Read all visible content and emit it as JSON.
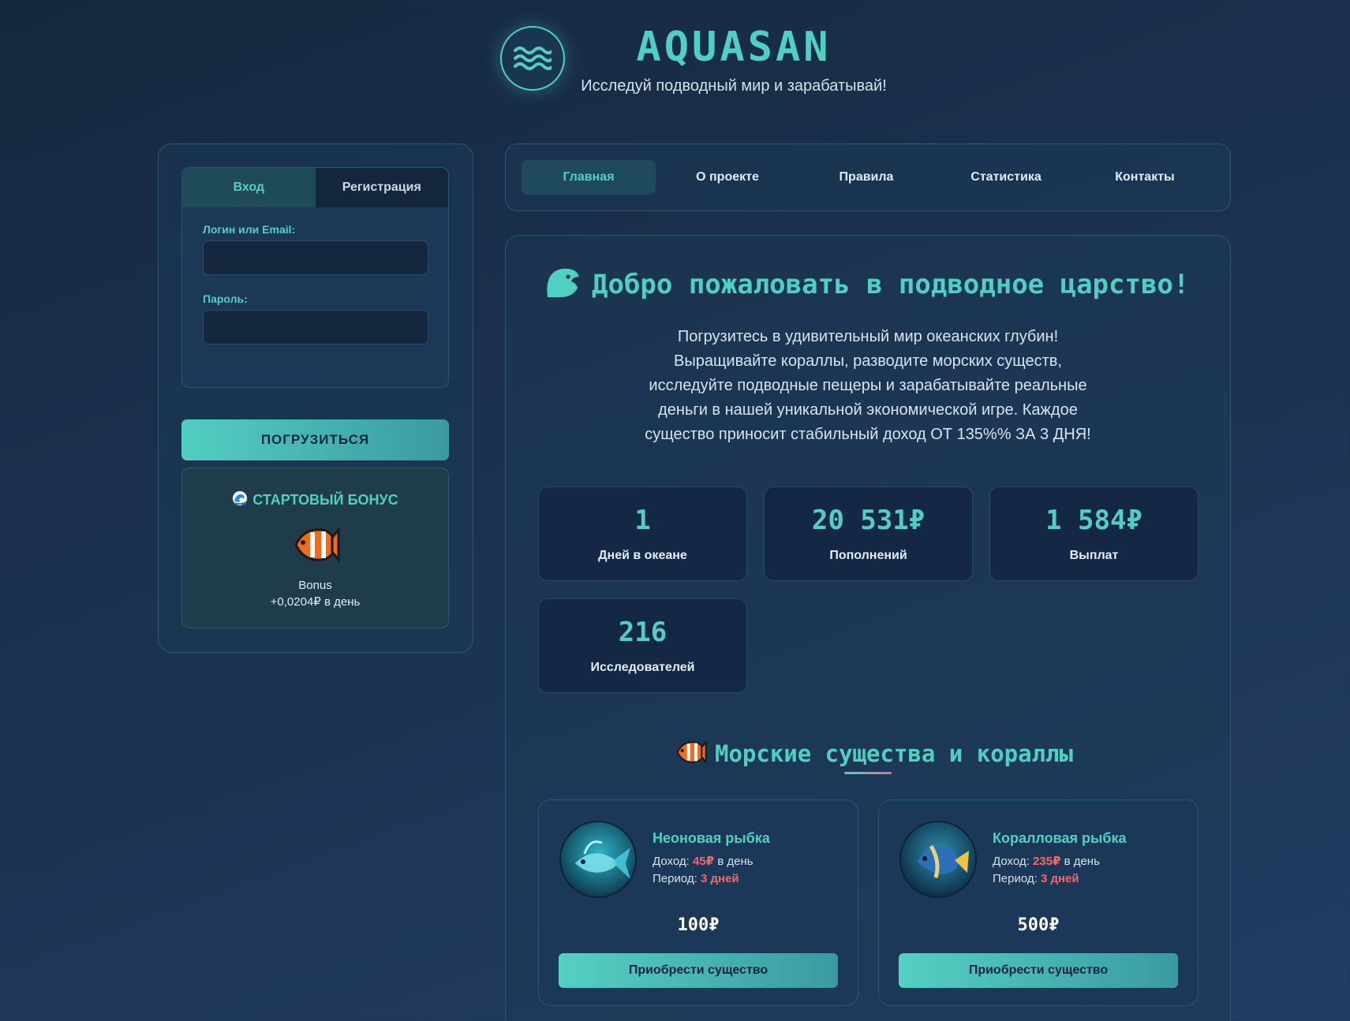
{
  "header": {
    "brand": "AQUASAN",
    "tagline": "Исследуй подводный мир и зарабатывай!",
    "logo_icon": "waves-icon"
  },
  "auth": {
    "tabs": [
      {
        "label": "Вход",
        "active": true
      },
      {
        "label": "Регистрация",
        "active": false
      }
    ],
    "login_label": "Логин или Email:",
    "login_value": "",
    "password_label": "Пароль:",
    "password_value": "",
    "submit_label": "ПОГРУЗИТЬСЯ"
  },
  "bonus": {
    "icon": "wave-icon",
    "title": "СТАРТОВЫЙ БОНУС",
    "creature_icon": "tropical-fish-icon",
    "name": "Bonus",
    "rate": "+0,0204₽ в день"
  },
  "nav": {
    "items": [
      {
        "label": "Главная",
        "active": true
      },
      {
        "label": "О проекте",
        "active": false
      },
      {
        "label": "Правила",
        "active": false
      },
      {
        "label": "Статистика",
        "active": false
      },
      {
        "label": "Контакты",
        "active": false
      }
    ]
  },
  "main": {
    "welcome_icon": "whale-icon",
    "welcome_title": "Добро пожаловать в подводное царство!",
    "intro_lines": [
      "Погрузитесь в удивительный мир океанских глубин!",
      "Выращивайте кораллы, разводите морских существ,",
      "исследуйте подводные пещеры и зарабатывайте реальные",
      "деньги в нашей уникальной экономической игре. Каждое",
      "существо приносит стабильный доход ОТ 135%% ЗА 3 ДНЯ!"
    ],
    "stats": [
      {
        "value": "1",
        "label": "Дней в океане"
      },
      {
        "value": "20 531₽",
        "label": "Пополнений"
      },
      {
        "value": "1 584₽",
        "label": "Выплат"
      },
      {
        "value": "216",
        "label": "Исследователей"
      }
    ],
    "section_icon": "tropical-fish-icon",
    "section_title": "Морские существа и кораллы",
    "creatures": [
      {
        "name": "Неоновая рыбка",
        "income_prefix": "Доход: ",
        "income_value": "45₽",
        "income_suffix": " в день",
        "period_prefix": "Период: ",
        "period_value": "3 дней",
        "price": "100₽",
        "button": "Приобрести существо"
      },
      {
        "name": "Коралловая рыбка",
        "income_prefix": "Доход: ",
        "income_value": "235₽",
        "income_suffix": " в день",
        "period_prefix": "Период: ",
        "period_value": "3 дней",
        "price": "500₽",
        "button": "Приобрести существо"
      }
    ]
  },
  "colors": {
    "accent": "#4ed1c2",
    "highlight": "#ef6a6a",
    "background": "#1b3250"
  }
}
